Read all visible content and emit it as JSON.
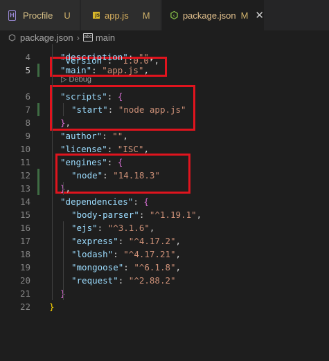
{
  "tabs": [
    {
      "icon": "heroku-icon",
      "label": "Procfile",
      "status": "U"
    },
    {
      "icon": "javascript-icon",
      "icon_text": "JS",
      "label": "app.js",
      "status": "M"
    },
    {
      "icon": "nodejs-icon",
      "label": "package.json",
      "status": "M",
      "close": "✕"
    }
  ],
  "breadcrumb": {
    "file": "package.json",
    "separator": "›",
    "symbol_icon_text": "abc",
    "symbol": "main"
  },
  "debug_label": "▷ Debug",
  "lines": [
    {
      "n": "4",
      "parts": [
        [
          "k",
          "\"description\""
        ],
        [
          "p",
          ": "
        ],
        [
          "s",
          "\"\""
        ],
        [
          "p",
          ","
        ]
      ]
    },
    {
      "n": "5",
      "parts": [
        [
          "k",
          "\"main\""
        ],
        [
          "p",
          ": "
        ],
        [
          "s",
          "\"app.js\""
        ],
        [
          "p",
          ","
        ]
      ]
    },
    {
      "n": "6",
      "parts": [
        [
          "k",
          "\"scripts\""
        ],
        [
          "p",
          ": "
        ],
        [
          "b2",
          "{"
        ]
      ]
    },
    {
      "n": "7",
      "parts": [
        [
          "k",
          "\"start\""
        ],
        [
          "p",
          ": "
        ],
        [
          "s",
          "\"node app.js\""
        ]
      ]
    },
    {
      "n": "8",
      "parts": [
        [
          "b2",
          "}"
        ],
        [
          "p",
          ","
        ]
      ]
    },
    {
      "n": "9",
      "parts": [
        [
          "k",
          "\"author\""
        ],
        [
          "p",
          ": "
        ],
        [
          "s",
          "\"\""
        ],
        [
          "p",
          ","
        ]
      ]
    },
    {
      "n": "10",
      "parts": [
        [
          "k",
          "\"license\""
        ],
        [
          "p",
          ": "
        ],
        [
          "s",
          "\"ISC\""
        ],
        [
          "p",
          ","
        ]
      ]
    },
    {
      "n": "11",
      "parts": [
        [
          "k",
          "\"engines\""
        ],
        [
          "p",
          ": "
        ],
        [
          "b2",
          "{"
        ]
      ]
    },
    {
      "n": "12",
      "parts": [
        [
          "k",
          "\"node\""
        ],
        [
          "p",
          ": "
        ],
        [
          "s",
          "\"14.18.3\""
        ]
      ]
    },
    {
      "n": "13",
      "parts": [
        [
          "b2",
          "}"
        ],
        [
          "p",
          ","
        ]
      ]
    },
    {
      "n": "14",
      "parts": [
        [
          "k",
          "\"dependencies\""
        ],
        [
          "p",
          ": "
        ],
        [
          "b2",
          "{"
        ]
      ]
    },
    {
      "n": "15",
      "parts": [
        [
          "k",
          "\"body-parser\""
        ],
        [
          "p",
          ": "
        ],
        [
          "s",
          "\"^1.19.1\""
        ],
        [
          "p",
          ","
        ]
      ]
    },
    {
      "n": "16",
      "parts": [
        [
          "k",
          "\"ejs\""
        ],
        [
          "p",
          ": "
        ],
        [
          "s",
          "\"^3.1.6\""
        ],
        [
          "p",
          ","
        ]
      ]
    },
    {
      "n": "17",
      "parts": [
        [
          "k",
          "\"express\""
        ],
        [
          "p",
          ": "
        ],
        [
          "s",
          "\"^4.17.2\""
        ],
        [
          "p",
          ","
        ]
      ]
    },
    {
      "n": "18",
      "parts": [
        [
          "k",
          "\"lodash\""
        ],
        [
          "p",
          ": "
        ],
        [
          "s",
          "\"^4.17.21\""
        ],
        [
          "p",
          ","
        ]
      ]
    },
    {
      "n": "19",
      "parts": [
        [
          "k",
          "\"mongoose\""
        ],
        [
          "p",
          ": "
        ],
        [
          "s",
          "\"^6.1.8\""
        ],
        [
          "p",
          ","
        ]
      ]
    },
    {
      "n": "20",
      "parts": [
        [
          "k",
          "\"request\""
        ],
        [
          "p",
          ": "
        ],
        [
          "s",
          "\"^2.88.2\""
        ]
      ]
    },
    {
      "n": "21",
      "parts": [
        [
          "b2",
          "}"
        ]
      ]
    },
    {
      "n": "22",
      "parts": [
        [
          "b1",
          "}"
        ]
      ]
    }
  ],
  "colors": {
    "highlight_box": "#e0141e",
    "modified_gutter": "#3f6d44",
    "string": "#ce9178",
    "key": "#9cdcfe"
  }
}
